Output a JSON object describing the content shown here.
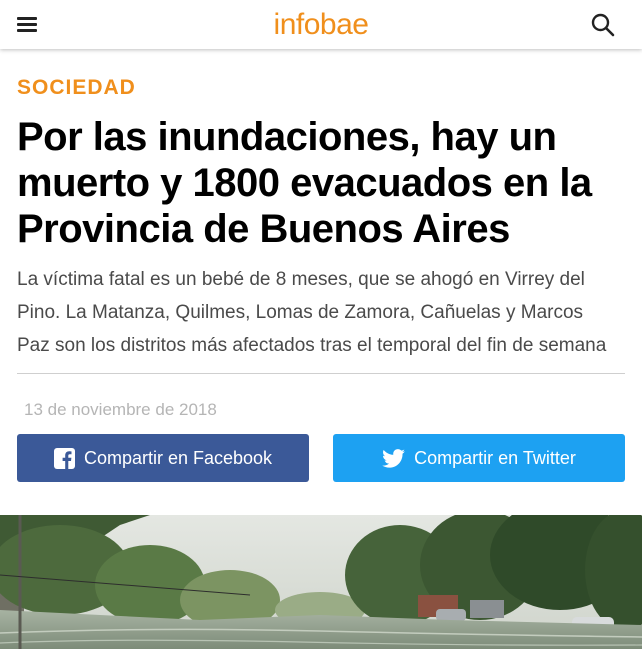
{
  "header": {
    "logo": "infobae",
    "menu_icon": "hamburger-menu-icon",
    "search_icon": "search-icon"
  },
  "article": {
    "section": "SOCIEDAD",
    "headline_lines": [
      "Por las inundaciones, hay un",
      "muerto y 1800 evacuados en la",
      "Provincia de Buenos Aires"
    ],
    "lead_lines": [
      "La víctima fatal es un bebé de 8 meses, que se ahogó en Virrey del",
      "Pino. La Matanza, Quilmes, Lomas de Zamora, Cañuelas y Marcos",
      "Paz son los distritos más afectados tras el temporal del fin de semana"
    ],
    "date": "13 de noviembre de 2018"
  },
  "share": {
    "facebook_label": "Compartir en Facebook",
    "twitter_label": "Compartir en Twitter",
    "facebook_color": "#3b5998",
    "twitter_color": "#1da1f2"
  },
  "colors": {
    "accent": "#f08f1c"
  }
}
